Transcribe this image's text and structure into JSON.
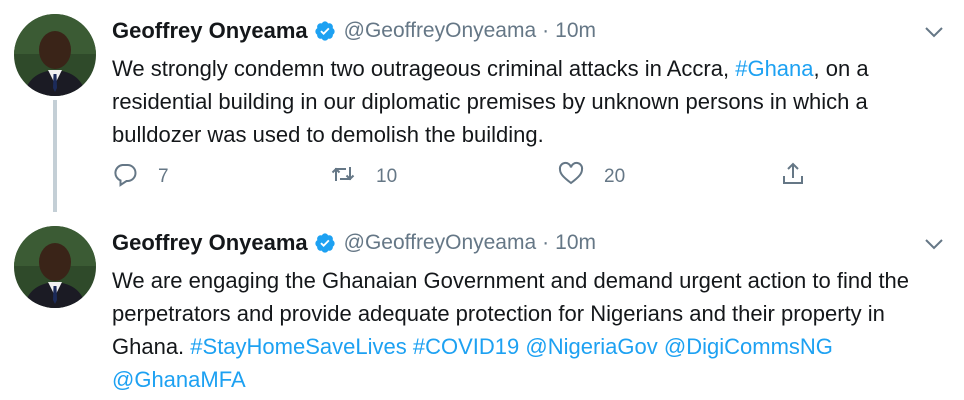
{
  "tweets": [
    {
      "author_name": "Geoffrey Onyeama",
      "handle": "@GeoffreyOnyeama",
      "separator": "·",
      "time": "10m",
      "text_parts": [
        "We strongly condemn two outrageous criminal attacks in Accra, ",
        "#Ghana",
        ", on a residential building in our diplomatic premises by unknown persons in which a bulldozer was used to demolish the building."
      ],
      "reply_count": "7",
      "retweet_count": "10",
      "like_count": "20"
    },
    {
      "author_name": "Geoffrey Onyeama",
      "handle": "@GeoffreyOnyeama",
      "separator": "·",
      "time": "10m",
      "text_parts": [
        "We are engaging the Ghanaian Government and demand urgent action to find the perpetrators and provide adequate protection for Nigerians and their property in Ghana. ",
        "#StayHomeSaveLives",
        " ",
        "#COVID19",
        " ",
        "@NigeriaGov",
        " ",
        "@DigiCommsNG",
        " ",
        "@GhanaMFA"
      ]
    }
  ],
  "colors": {
    "link": "#1da1f2",
    "secondary_text": "#657786",
    "thread_line": "#c4cfd6",
    "verified_badge": "#1da1f2"
  },
  "icons": {
    "verified": "verified-badge-icon",
    "caret": "chevron-down-icon",
    "reply": "reply-icon",
    "retweet": "retweet-icon",
    "like": "heart-icon",
    "share": "share-icon"
  }
}
